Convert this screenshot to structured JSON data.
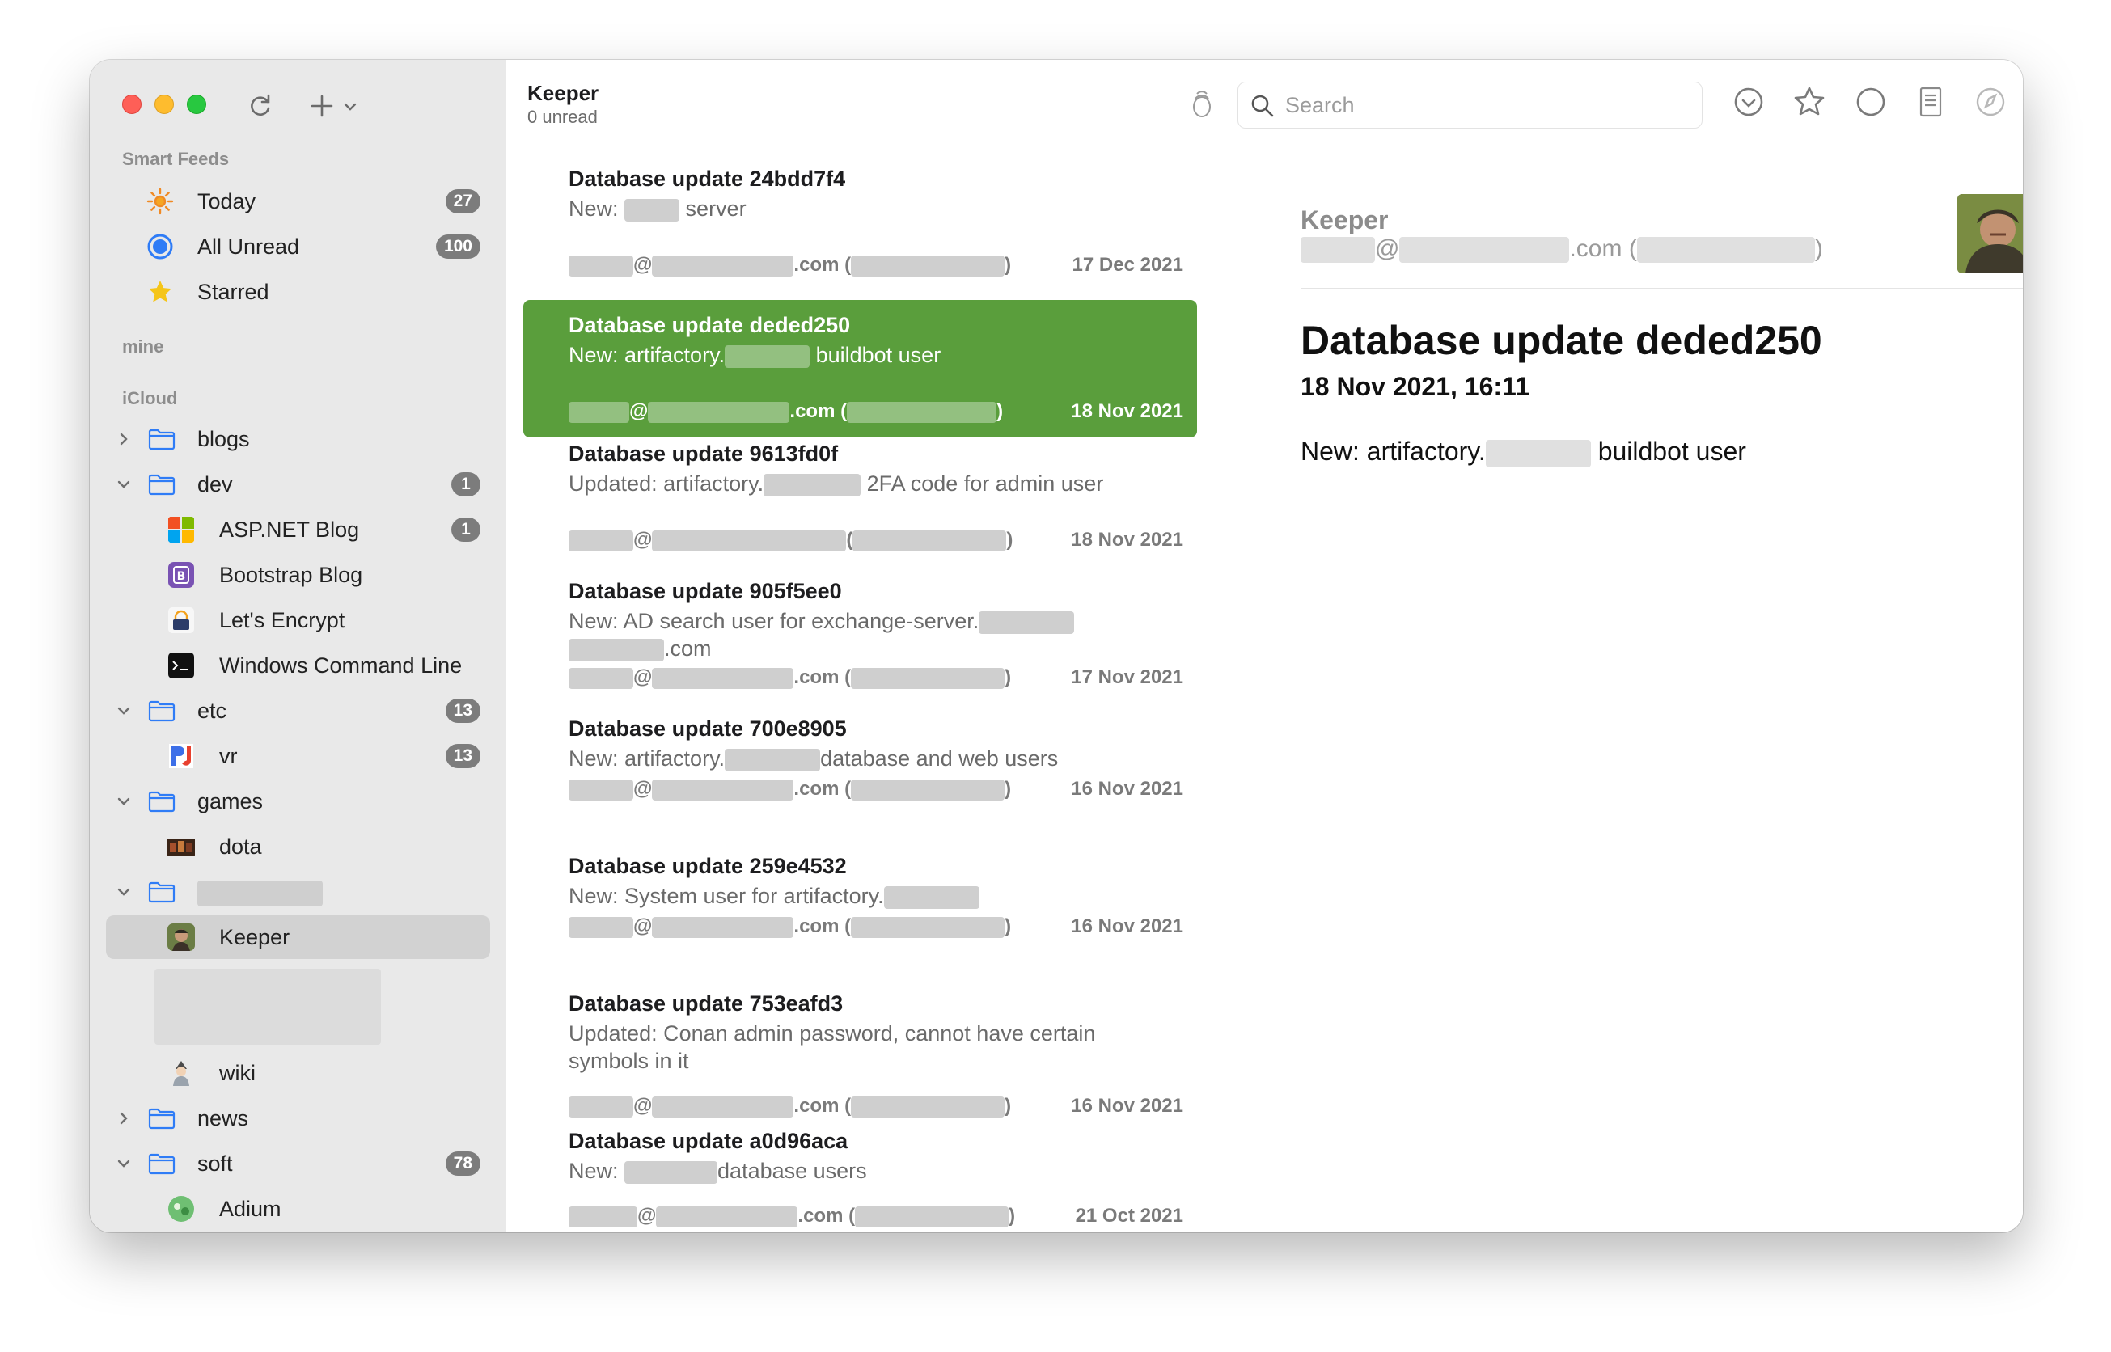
{
  "sidebar": {
    "smart_feeds_heading": "Smart Feeds",
    "smart_feeds": [
      {
        "label": "Today",
        "count": "27"
      },
      {
        "label": "All Unread",
        "count": "100"
      },
      {
        "label": "Starred",
        "count": ""
      }
    ],
    "mine_heading": "mine",
    "icloud_heading": "iCloud",
    "folders": {
      "blogs": "blogs",
      "dev": {
        "label": "dev",
        "count": "1"
      },
      "aspnet": {
        "label": "ASP.NET Blog",
        "count": "1"
      },
      "bootstrap": "Bootstrap Blog",
      "letsencrypt": "Let's Encrypt",
      "wcl": "Windows Command Line",
      "etc": {
        "label": "etc",
        "count": "13"
      },
      "vr": {
        "label": "vr",
        "count": "13"
      },
      "games": "games",
      "dota": "dota",
      "keeper": "Keeper",
      "wiki": "wiki",
      "news": "news",
      "soft": {
        "label": "soft",
        "count": "78"
      },
      "adium": "Adium"
    }
  },
  "list": {
    "title": "Keeper",
    "subtitle": "0 unread",
    "articles": [
      {
        "title": "Database update 24bdd7f4",
        "date": "17 Dec 2021"
      },
      {
        "title": "Database update deded250",
        "date": "18 Nov 2021"
      },
      {
        "title": "Database update 9613fd0f",
        "date": "18 Nov 2021"
      },
      {
        "title": "Database update 905f5ee0",
        "date": "17 Nov 2021"
      },
      {
        "title": "Database update 700e8905",
        "date": "16 Nov 2021"
      },
      {
        "title": "Database update 259e4532",
        "date": "16 Nov 2021"
      },
      {
        "title": "Database update 753eafd3",
        "date": "16 Nov 2021"
      },
      {
        "title": "Database update a0d96aca",
        "date": "21 Oct 2021"
      }
    ],
    "text": {
      "new": "New:",
      "updated": "Updated:",
      "server": "server",
      "artifactory": "artifactory.",
      "buildbot": "buildbot user",
      "twofa": "2FA code for admin user",
      "ad_search": "New: AD search user for exchange-server.",
      "dotcom": ".com",
      "db_web": "database and web users",
      "system_user": "New: System user for artifactory.",
      "conan": "Updated: Conan admin password, cannot have certain symbols in it",
      "db_users": "database users",
      "at": "@",
      "com_open": ".com (",
      "open_paren": "(",
      "close_paren": ")"
    }
  },
  "reader": {
    "search_placeholder": "Search",
    "feed_name": "Keeper",
    "author_at": "@",
    "author_com": ".com (",
    "author_close": ")",
    "title": "Database update deded250",
    "datetime": "18 Nov 2021, 16:11",
    "body_prefix": "New: artifactory.",
    "body_suffix": "buildbot user"
  },
  "colors": {
    "selection_green": "#5a9e3c",
    "sidebar_bg": "#e9e9e9",
    "badge_gray": "#7c7c7c"
  }
}
